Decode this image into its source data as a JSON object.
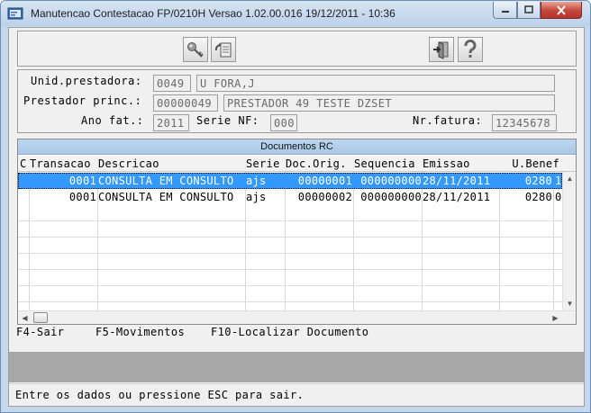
{
  "window": {
    "title": "Manutencao Contestacao FP/0210H Versao 1.02.00.016 19/12/2011 - 10:36",
    "icons": {
      "app": "progress-app-icon",
      "minimize": "minimize-icon",
      "maximize": "maximize-icon",
      "close": "close-icon"
    }
  },
  "toolbar": {
    "buttons": [
      {
        "name": "key-icon"
      },
      {
        "name": "refresh-document-icon"
      },
      {
        "name": "exit-door-icon"
      },
      {
        "name": "help-icon"
      }
    ]
  },
  "form": {
    "unid_label": "Unid.prestadora:",
    "unid_code": "0049",
    "unid_name": "U FORA,J",
    "prestador_label": "Prestador princ.:",
    "prestador_code": "00000049",
    "prestador_name": "PRESTADOR 49 TESTE DZSET",
    "ano_label": "Ano fat.:",
    "ano_value": "2011",
    "serie_label": "Serie NF:",
    "serie_value": "000",
    "nrfatura_label": "Nr.fatura:",
    "nrfatura_value": "12345678"
  },
  "grid": {
    "caption": "Documentos RC",
    "columns": [
      "C",
      "Transacao",
      "Descricao",
      "Serie",
      "Doc.Orig.",
      "Sequencia",
      "Emissao",
      "U.Benef"
    ],
    "rows": [
      {
        "c": "",
        "transacao": "0001",
        "descricao": "CONSULTA EM CONSULTO",
        "serie": "ajs",
        "doc": "00000001",
        "sequencia": "000000000",
        "emissao": "28/11/2011",
        "ubenef": "0280",
        "extra": "1",
        "selected": true
      },
      {
        "c": "",
        "transacao": "0001",
        "descricao": "CONSULTA EM CONSULTO",
        "serie": "ajs",
        "doc": "00000002",
        "sequencia": "000000000",
        "emissao": "28/11/2011",
        "ubenef": "0280",
        "extra": "0",
        "selected": false
      }
    ]
  },
  "fkeys": {
    "f4": "F4-Sair",
    "f5": "F5-Movimentos",
    "f10": "F10-Localizar Documento"
  },
  "status": {
    "message": "Entre os dados ou pressione ESC para sair."
  }
}
